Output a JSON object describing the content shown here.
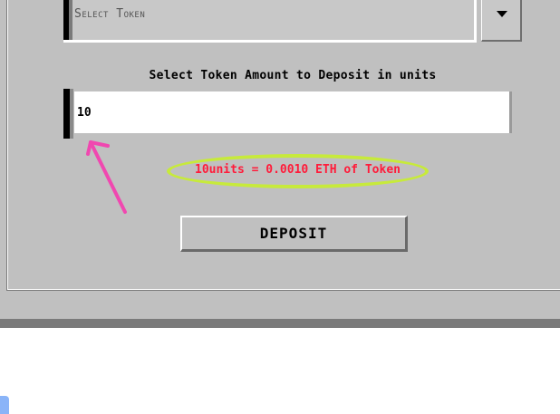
{
  "token_select": {
    "placeholder": "Select Token",
    "dropdown_icon": "chevron-down-icon"
  },
  "amount": {
    "label": "Select Token Amount to Deposit in units",
    "value": "10"
  },
  "conversion": {
    "text": "10units = 0.0010 ETH of Token",
    "text_color": "#ff1b3a",
    "highlight_color": "#c7ea3b"
  },
  "annotation": {
    "arrow_icon": "arrow-pointer-icon",
    "arrow_color": "#f048b0"
  },
  "deposit": {
    "label": "DEPOSIT"
  }
}
